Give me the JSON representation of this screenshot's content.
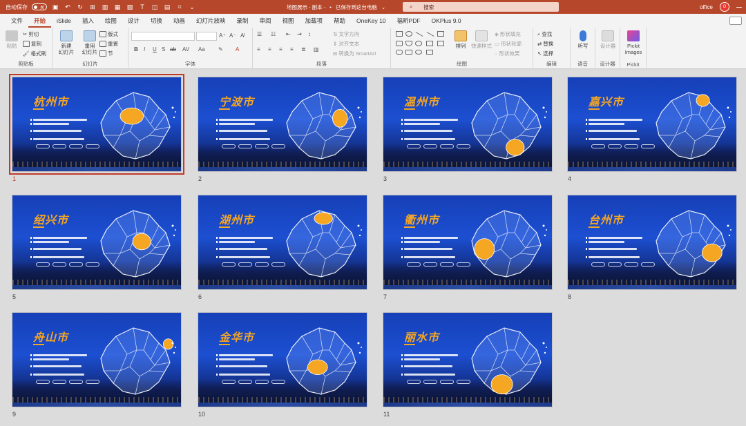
{
  "titlebar": {
    "autosave_label": "自动保存",
    "autosave_state": "关",
    "file_title": "地图展示 - 副本 -",
    "save_status": "已保存到这台电脑",
    "search_placeholder": "搜索",
    "account": "office",
    "avatar_letter": "O"
  },
  "tabs": [
    "文件",
    "开始",
    "iSlide",
    "插入",
    "绘图",
    "设计",
    "切换",
    "动画",
    "幻灯片放映",
    "录制",
    "审阅",
    "视图",
    "加载项",
    "帮助",
    "OneKey 10",
    "福昕PDF",
    "OKPlus 9.0"
  ],
  "active_tab": "开始",
  "ribbon": {
    "clipboard": {
      "label": "剪贴板",
      "paste": "粘贴",
      "cut": "剪切",
      "copy": "复制",
      "format_painter": "格式刷"
    },
    "slides": {
      "label": "幻灯片",
      "new_slide": "新建",
      "new_slide2": "幻灯片",
      "reuse": "重用",
      "reuse2": "幻灯片",
      "layout": "版式",
      "reset": "重置",
      "section": "节"
    },
    "font": {
      "label": "字体"
    },
    "paragraph": {
      "label": "段落",
      "text_direction": "文字方向",
      "align_text": "对齐文本",
      "smartart": "转换为 SmartArt"
    },
    "drawing": {
      "label": "绘图",
      "arrange": "排列",
      "quick_styles": "快速样式",
      "fill": "形状填充",
      "outline": "形状轮廓",
      "effects": "形状效果"
    },
    "editing": {
      "label": "编辑",
      "find": "查找",
      "replace": "替换",
      "select": "选择"
    },
    "voice": {
      "label": "语音",
      "dictate": "听写"
    },
    "designer": {
      "label": "设计器",
      "designer_btn": "设计器"
    },
    "pickit": {
      "label": "Pickit",
      "btn1": "Pickit",
      "btn2": "Images"
    }
  },
  "slides": [
    {
      "num": "1",
      "title": "杭州市",
      "selected": true
    },
    {
      "num": "2",
      "title": "宁波市",
      "selected": false
    },
    {
      "num": "3",
      "title": "温州市",
      "selected": false
    },
    {
      "num": "4",
      "title": "嘉兴市",
      "selected": false
    },
    {
      "num": "5",
      "title": "绍兴市",
      "selected": false
    },
    {
      "num": "6",
      "title": "湖州市",
      "selected": false
    },
    {
      "num": "7",
      "title": "衢州市",
      "selected": false
    },
    {
      "num": "8",
      "title": "台州市",
      "selected": false
    },
    {
      "num": "9",
      "title": "舟山市",
      "selected": false
    },
    {
      "num": "10",
      "title": "金华市",
      "selected": false
    },
    {
      "num": "11",
      "title": "丽水市",
      "selected": false
    }
  ],
  "colors": {
    "accent": "#b7472a",
    "highlight": "#f5a623",
    "slide_bg": "#1c4fd1",
    "selection": "#c0392b"
  }
}
